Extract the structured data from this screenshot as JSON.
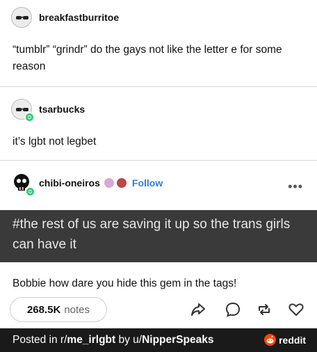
{
  "posts": [
    {
      "username": "breakfastburritoe",
      "text": "“tumblr” “grindr” do the gays not like the letter e for some reason"
    },
    {
      "username": "tsarbucks",
      "text": "it’s lgbt not legbet"
    },
    {
      "username": "chibi-oneiros",
      "follow_label": "Follow",
      "tags": "#the rest of us are saving it up so the trans girls can have it",
      "text": "Bobbie how dare you hide this gem in the tags!"
    }
  ],
  "notes": {
    "count": "268.5K",
    "label": "notes"
  },
  "footer": {
    "prefix": "Posted in r/",
    "subreddit": "me_irlgbt",
    "middle": " by u/",
    "user": "NipperSpeaks",
    "brand": "reddit"
  },
  "colors": {
    "accent": "#2f7ee6",
    "reddit": "#ff4500",
    "badge": "#2ecc71",
    "tag_band": "#3a3a3a",
    "footer_bg": "#1a1a1b"
  },
  "icons": [
    "share-icon",
    "reply-icon",
    "reblog-icon",
    "heart-icon",
    "more-icon"
  ]
}
